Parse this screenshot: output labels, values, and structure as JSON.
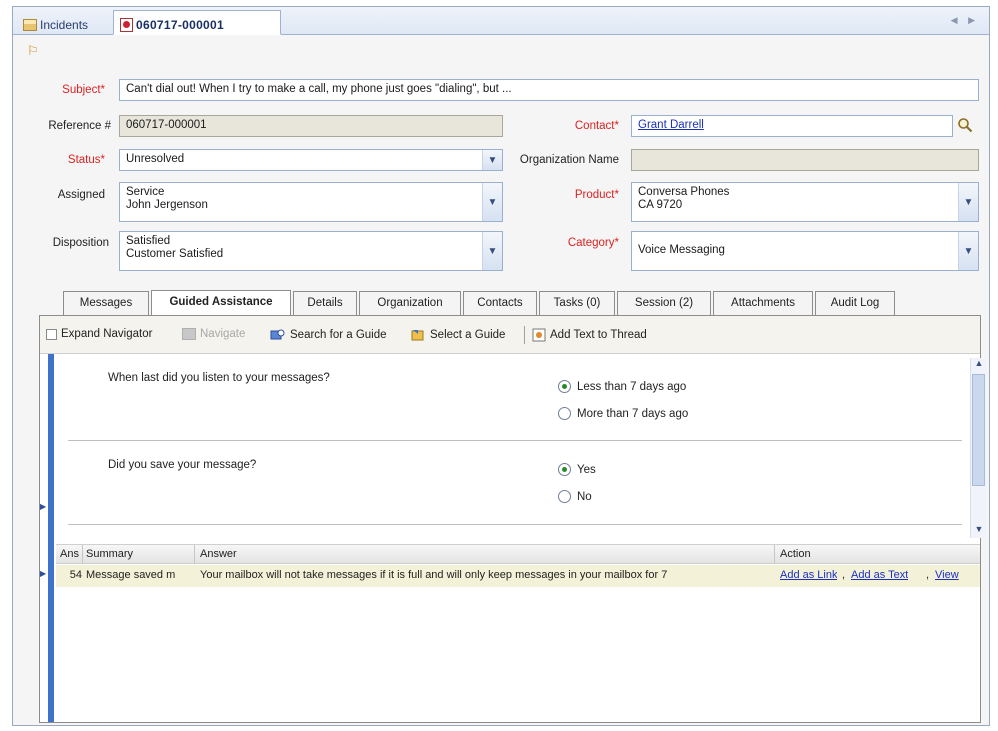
{
  "doc_tabs": {
    "incidents_label": "Incidents",
    "active_label": "060717-000001"
  },
  "form": {
    "subject": {
      "label": "Subject",
      "value": "Can't dial out! When I try to make a call, my phone just goes \"dialing\", but ..."
    },
    "reference": {
      "label": "Reference #",
      "value": "060717-000001"
    },
    "contact": {
      "label": "Contact",
      "value": "Grant Darrell"
    },
    "status": {
      "label": "Status",
      "value": "Unresolved"
    },
    "organization_name": {
      "label": "Organization Name",
      "value": ""
    },
    "assigned": {
      "label": "Assigned",
      "line1": "Service",
      "line2": "John Jergenson"
    },
    "product": {
      "label": "Product",
      "line1": "Conversa Phones",
      "line2": "CA 9720"
    },
    "disposition": {
      "label": "Disposition",
      "line1": "Satisfied",
      "line2": "Customer Satisfied"
    },
    "category": {
      "label": "Category",
      "value": "Voice Messaging"
    },
    "required_mark": "*"
  },
  "subtabs": [
    "Messages",
    "Guided Assistance",
    "Details",
    "Organization",
    "Contacts",
    "Tasks (0)",
    "Session (2)",
    "Attachments",
    "Audit Log"
  ],
  "toolbar": {
    "expand_navigator": "Expand Navigator",
    "navigate": "Navigate",
    "search_guide": "Search for a Guide",
    "select_guide": "Select a Guide",
    "add_text": "Add Text to Thread"
  },
  "guide": {
    "q1": {
      "text": "When last did you listen to your messages?",
      "opt1": "Less than 7 days ago",
      "opt2": "More than 7 days ago"
    },
    "q2": {
      "text": "Did you save your message?",
      "opt1": "Yes",
      "opt2": "No"
    }
  },
  "grid": {
    "headers": {
      "ans": "Ans",
      "summary": "Summary",
      "answer": "Answer",
      "action": "Action"
    },
    "row": {
      "ans": "54",
      "summary": "Message saved m",
      "answer": "Your mailbox will not take messages if it is full and will only keep messages in your mailbox for 7",
      "action_link": "Add as Link",
      "action_text": "Add as Text",
      "action_view": "View",
      "sep": ","
    }
  },
  "colors": {
    "accent": "#3f72c9",
    "required": "#dd2222",
    "link": "#1a2fbf"
  }
}
